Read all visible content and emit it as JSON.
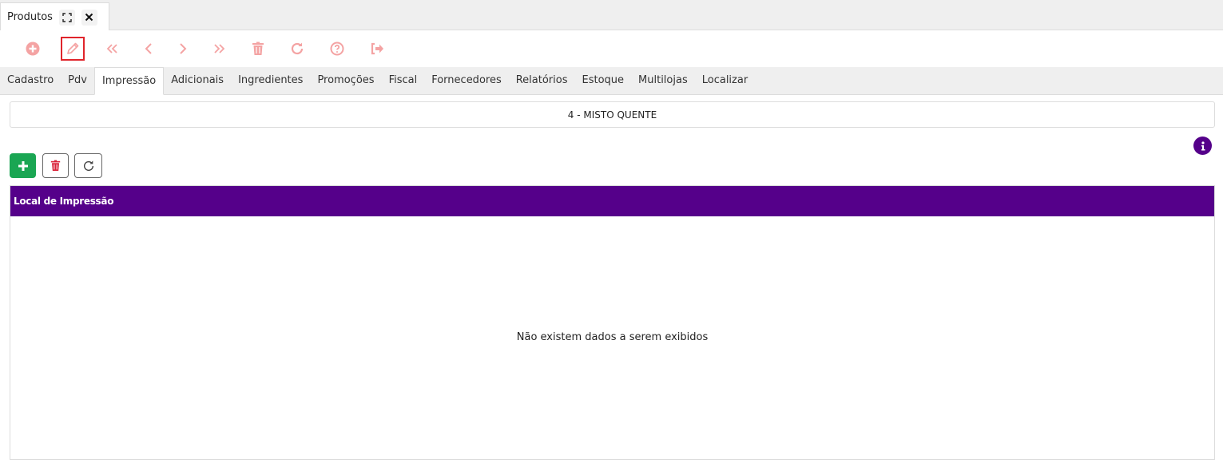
{
  "window_tab": {
    "title": "Produtos",
    "expand_icon": "expand-icon",
    "close_icon": "close-icon"
  },
  "toolbar": {
    "icon_color": "#f4a3a3",
    "active_color": "#e0242b",
    "buttons": [
      {
        "name": "add-button",
        "icon": "plus-circle-icon"
      },
      {
        "name": "edit-button",
        "icon": "pencil-icon",
        "active": true
      },
      {
        "name": "first-button",
        "icon": "double-chevron-left-icon"
      },
      {
        "name": "previous-button",
        "icon": "chevron-left-icon"
      },
      {
        "name": "next-button",
        "icon": "chevron-right-icon"
      },
      {
        "name": "last-button",
        "icon": "double-chevron-right-icon"
      },
      {
        "name": "delete-button",
        "icon": "trash-icon"
      },
      {
        "name": "refresh-button",
        "icon": "refresh-icon"
      },
      {
        "name": "help-button",
        "icon": "question-circle-icon"
      },
      {
        "name": "exit-button",
        "icon": "sign-out-icon"
      }
    ]
  },
  "form_tabs": [
    {
      "label": "Cadastro"
    },
    {
      "label": "Pdv"
    },
    {
      "label": "Impressão",
      "selected": true
    },
    {
      "label": "Adicionais"
    },
    {
      "label": "Ingredientes"
    },
    {
      "label": "Promoções"
    },
    {
      "label": "Fiscal"
    },
    {
      "label": "Fornecedores"
    },
    {
      "label": "Relatórios"
    },
    {
      "label": "Estoque"
    },
    {
      "label": "Multilojas"
    },
    {
      "label": "Localizar"
    }
  ],
  "product": {
    "title": "4 - MISTO QUENTE"
  },
  "grid_actions": {
    "add_icon": "plus-icon",
    "delete_icon": "trash-icon",
    "refresh_icon": "refresh-icon",
    "add_color": "#1aa653",
    "delete_color": "#d9243a"
  },
  "info_icon": "info-icon",
  "grid": {
    "header_color": "#55008a",
    "columns": [
      "Local de Impressão"
    ],
    "empty_message": "Não existem dados a serem exibidos"
  }
}
